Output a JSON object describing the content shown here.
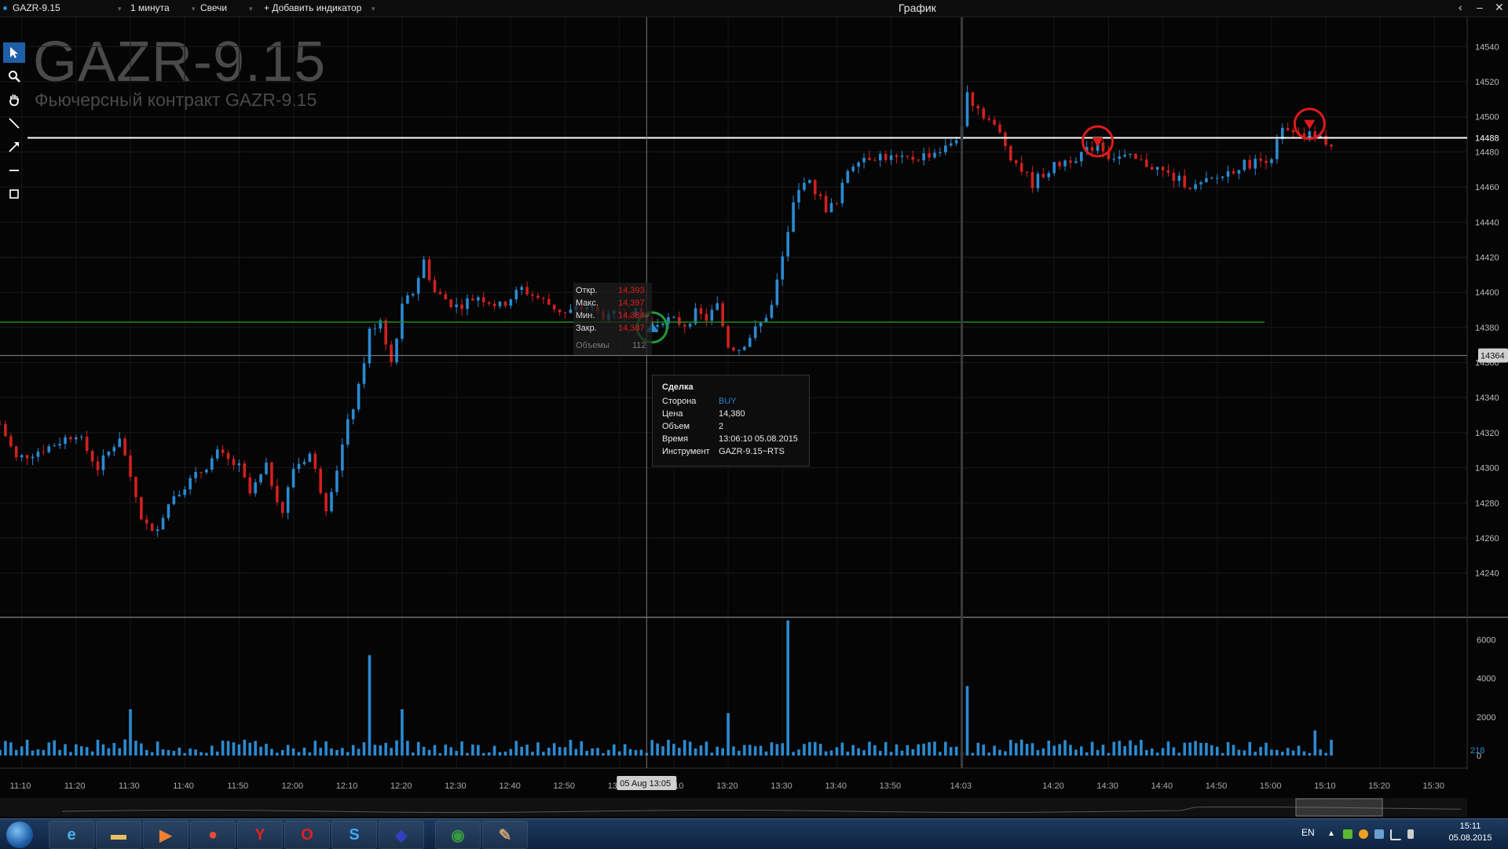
{
  "window": {
    "instrument": "GAZR-9.15",
    "interval": "1 минута",
    "chart_type": "Свечи",
    "add_indicator": "+ Добавить индикатор",
    "title": "График"
  },
  "header": {
    "symbol": "GAZR-9.15",
    "description": "Фьючерсный контракт GAZR-9.15"
  },
  "toolbar": {
    "tools": [
      "cursor-icon",
      "zoom-icon",
      "pan-hand-icon",
      "line-icon",
      "arrow-icon",
      "horizontal-line-icon",
      "rectangle-icon"
    ]
  },
  "ohlc": {
    "open_label": "Откр.",
    "open": "14,393",
    "high_label": "Макс.",
    "high": "14,397",
    "low_label": "Мин.",
    "low": "14,384",
    "close_label": "Закр.",
    "close": "14,387",
    "volume_label": "Объемы",
    "volume": "112"
  },
  "trade_tooltip": {
    "title": "Сделка",
    "side_label": "Сторона",
    "side": "BUY",
    "price_label": "Цена",
    "price": "14,380",
    "qty_label": "Объем",
    "qty": "2",
    "time_label": "Время",
    "time": "13:06:10 05.08.2015",
    "instrument_label": "Инструмент",
    "instrument": "GAZR-9.15~RTS"
  },
  "price_axis": {
    "ticks": [
      "14540",
      "14520",
      "14500",
      "14480",
      "14460",
      "14440",
      "14420",
      "14400",
      "14380",
      "14360",
      "14340",
      "14320",
      "14300",
      "14280",
      "14260",
      "14240"
    ],
    "last_price": "14488",
    "crosshair_price": "14364",
    "levels": {
      "white": 14488,
      "green": 14383,
      "gray": 14364
    }
  },
  "volume_axis": {
    "ticks": [
      "6000",
      "4000",
      "2000",
      "0"
    ],
    "last_volume": "218"
  },
  "time_axis": {
    "ticks": [
      "11:10",
      "11:20",
      "11:30",
      "11:40",
      "11:50",
      "12:00",
      "12:10",
      "12:20",
      "12:30",
      "12:40",
      "12:50",
      "13:00",
      "13:10",
      "13:20",
      "13:30",
      "13:40",
      "13:50",
      "14:03",
      "14:20",
      "14:30",
      "14:40",
      "14:50",
      "15:00",
      "15:10",
      "15:20",
      "15:30"
    ],
    "crosshair_label": "05 Aug 13:05"
  },
  "markers": [
    {
      "type": "buy",
      "time": "13:06",
      "price": 14380,
      "circle_color": "#1f9a3a"
    },
    {
      "type": "sell",
      "time": "14:28",
      "price": 14486,
      "circle_color": "#e01b1b"
    },
    {
      "type": "sell",
      "time": "15:07",
      "price": 14496,
      "circle_color": "#e01b1b"
    }
  ],
  "colors": {
    "up": "#2b8ad1",
    "down": "#d12020",
    "volume": "#2b8ad1",
    "background": "#050505"
  },
  "chart_data": {
    "type": "candlestick",
    "x_range": [
      "11:06",
      "15:36"
    ],
    "y_range": [
      14230,
      14550
    ],
    "keypoints": [
      [
        "11:06",
        14325
      ],
      [
        "11:09",
        14305
      ],
      [
        "11:15",
        14312
      ],
      [
        "11:20",
        14320
      ],
      [
        "11:24",
        14300
      ],
      [
        "11:28",
        14318
      ],
      [
        "11:32",
        14272
      ],
      [
        "11:34",
        14262
      ],
      [
        "11:38",
        14285
      ],
      [
        "11:42",
        14295
      ],
      [
        "11:46",
        14308
      ],
      [
        "11:50",
        14300
      ],
      [
        "11:52",
        14285
      ],
      [
        "11:55",
        14300
      ],
      [
        "11:58",
        14275
      ],
      [
        "12:00",
        14300
      ],
      [
        "12:03",
        14308
      ],
      [
        "12:06",
        14278
      ],
      [
        "12:08",
        14300
      ],
      [
        "12:10",
        14325
      ],
      [
        "12:12",
        14345
      ],
      [
        "12:14",
        14378
      ],
      [
        "12:16",
        14385
      ],
      [
        "12:18",
        14360
      ],
      [
        "12:20",
        14392
      ],
      [
        "12:22",
        14400
      ],
      [
        "12:24",
        14418
      ],
      [
        "12:26",
        14400
      ],
      [
        "12:30",
        14392
      ],
      [
        "12:34",
        14398
      ],
      [
        "12:38",
        14392
      ],
      [
        "12:42",
        14402
      ],
      [
        "12:46",
        14395
      ],
      [
        "12:50",
        14388
      ],
      [
        "12:54",
        14392
      ],
      [
        "12:58",
        14385
      ],
      [
        "13:01",
        14390
      ],
      [
        "13:04",
        14387
      ],
      [
        "13:06",
        14380
      ],
      [
        "13:08",
        14385
      ],
      [
        "13:12",
        14382
      ],
      [
        "13:14",
        14388
      ],
      [
        "13:16",
        14385
      ],
      [
        "13:18",
        14392
      ],
      [
        "13:20",
        14370
      ],
      [
        "13:22",
        14368
      ],
      [
        "13:24",
        14375
      ],
      [
        "13:26",
        14382
      ],
      [
        "13:28",
        14392
      ],
      [
        "13:30",
        14420
      ],
      [
        "13:32",
        14450
      ],
      [
        "13:34",
        14465
      ],
      [
        "13:36",
        14458
      ],
      [
        "13:38",
        14448
      ],
      [
        "13:40",
        14450
      ],
      [
        "13:42",
        14470
      ],
      [
        "13:44",
        14477
      ],
      [
        "13:48",
        14478
      ],
      [
        "13:52",
        14475
      ],
      [
        "13:56",
        14478
      ],
      [
        "14:00",
        14482
      ],
      [
        "14:03",
        14492
      ],
      [
        "14:04",
        14512
      ],
      [
        "14:06",
        14505
      ],
      [
        "14:08",
        14498
      ],
      [
        "14:10",
        14490
      ],
      [
        "14:12",
        14478
      ],
      [
        "14:14",
        14470
      ],
      [
        "14:16",
        14462
      ],
      [
        "14:18",
        14468
      ],
      [
        "14:22",
        14475
      ],
      [
        "14:26",
        14480
      ],
      [
        "14:28",
        14486
      ],
      [
        "14:30",
        14478
      ],
      [
        "14:34",
        14476
      ],
      [
        "14:38",
        14472
      ],
      [
        "14:42",
        14465
      ],
      [
        "14:46",
        14460
      ],
      [
        "14:50",
        14465
      ],
      [
        "14:54",
        14472
      ],
      [
        "14:58",
        14475
      ],
      [
        "15:00",
        14478
      ],
      [
        "15:02",
        14492
      ],
      [
        "15:05",
        14488
      ],
      [
        "15:08",
        14490
      ],
      [
        "15:11",
        14484
      ]
    ],
    "volume_spikes": [
      [
        "12:14",
        5200
      ],
      [
        "13:31",
        7000
      ],
      [
        "14:04",
        3600
      ],
      [
        "13:20",
        2200
      ],
      [
        "11:30",
        2400
      ],
      [
        "12:20",
        2400
      ],
      [
        "15:08",
        1300
      ]
    ],
    "volume_baseline": 400,
    "volume_range": [
      0,
      7000
    ]
  }
}
